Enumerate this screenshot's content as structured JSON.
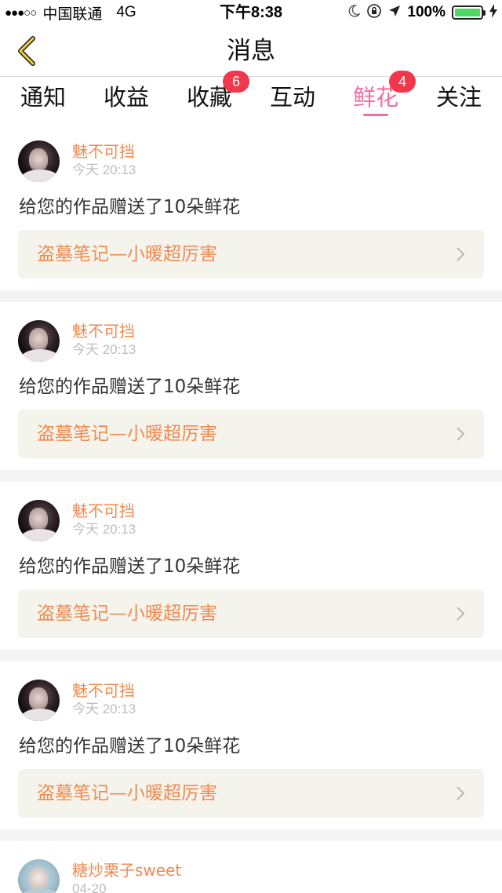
{
  "status_bar": {
    "signal": "●●●○○",
    "carrier": "中国联通",
    "network": "4G",
    "time": "下午8:38",
    "dnd_icon": "moon-icon",
    "lock_icon": "rotation-lock-icon",
    "location_icon": "location-arrow-icon",
    "battery": "100%",
    "battery_level": 1.0,
    "charge_icon": "bolt-icon",
    "battery_color": "#4cd964"
  },
  "nav": {
    "back_icon": "chevron-left-icon",
    "title": "消息"
  },
  "tabs": [
    {
      "label": "通知",
      "badge": "",
      "active": false
    },
    {
      "label": "收益",
      "badge": "",
      "active": false
    },
    {
      "label": "收藏",
      "badge": "6",
      "active": false
    },
    {
      "label": "互动",
      "badge": "",
      "active": false
    },
    {
      "label": "鲜花",
      "badge": "4",
      "active": true
    },
    {
      "label": "关注",
      "badge": "",
      "active": false
    }
  ],
  "colors": {
    "accent_pink": "#f06fa3",
    "accent_orange": "#f2894f",
    "badge_red": "#f0374c"
  },
  "notifications": [
    {
      "username": "魅不可挡",
      "time": "今天 20:13",
      "message": "给您的作品赠送了10朵鲜花",
      "work_title": "盗墓笔记—小暖超厉害"
    },
    {
      "username": "魅不可挡",
      "time": "今天 20:13",
      "message": "给您的作品赠送了10朵鲜花",
      "work_title": "盗墓笔记—小暖超厉害"
    },
    {
      "username": "魅不可挡",
      "time": "今天 20:13",
      "message": "给您的作品赠送了10朵鲜花",
      "work_title": "盗墓笔记—小暖超厉害"
    },
    {
      "username": "魅不可挡",
      "time": "今天 20:13",
      "message": "给您的作品赠送了10朵鲜花",
      "work_title": "盗墓笔记—小暖超厉害"
    },
    {
      "username": "糖炒栗子sweet",
      "time": "04-20",
      "message": "",
      "work_title": ""
    }
  ]
}
